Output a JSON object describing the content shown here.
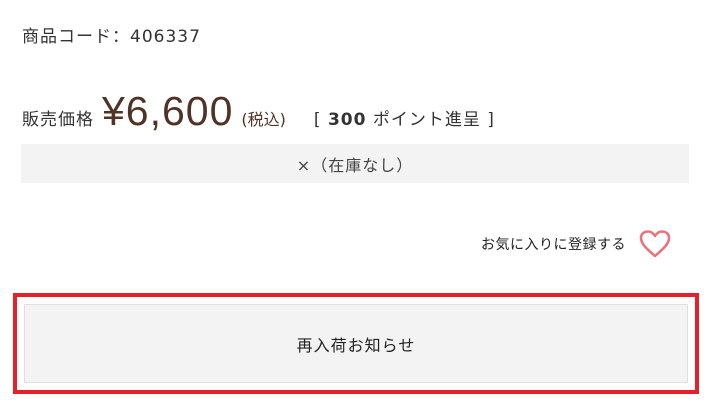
{
  "product": {
    "code_label": "商品コード：406337"
  },
  "price": {
    "label": "販売価格",
    "value": "¥6,600",
    "tax_note": "(税込)",
    "points_open": "[ ",
    "points_value": "300",
    "points_suffix": " ポイント進呈 ]"
  },
  "stock": {
    "status": "×（在庫なし）"
  },
  "favorite": {
    "label": "お気に入りに登録する",
    "icon": "heart-outline-icon",
    "icon_color": "#e8757e"
  },
  "restock": {
    "button_label": "再入荷お知らせ",
    "highlight_color": "#e3202c"
  }
}
